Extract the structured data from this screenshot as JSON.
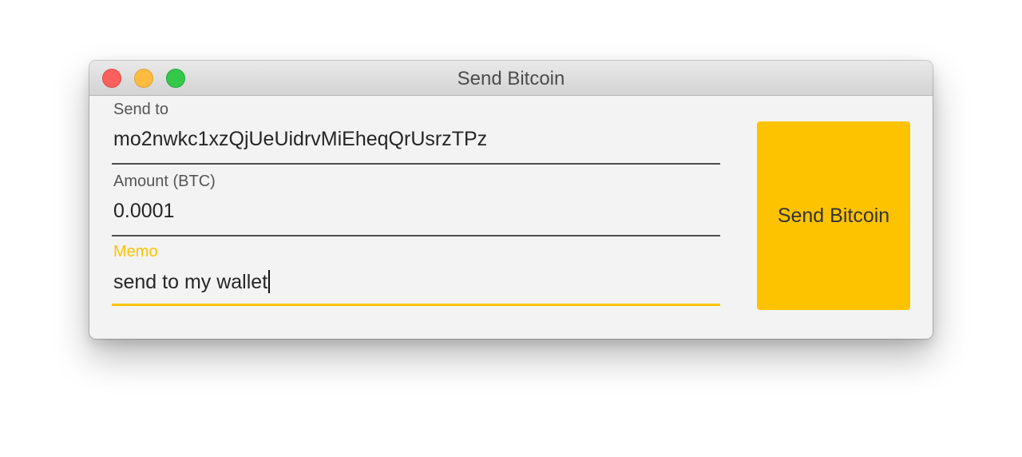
{
  "window": {
    "title": "Send Bitcoin"
  },
  "form": {
    "send_to": {
      "label": "Send to",
      "value": "mo2nwkc1xzQjUeUidrvMiEheqQrUsrzTPz"
    },
    "amount": {
      "label": "Amount (BTC)",
      "value": "0.0001"
    },
    "memo": {
      "label": "Memo",
      "value": "send to my wallet",
      "focused": true
    }
  },
  "actions": {
    "send_label": "Send Bitcoin"
  },
  "colors": {
    "accent": "#fdc300",
    "window_bg": "#f3f3f3",
    "close": "#fc605c",
    "minimize": "#fdbc40",
    "zoom": "#34c84a"
  }
}
